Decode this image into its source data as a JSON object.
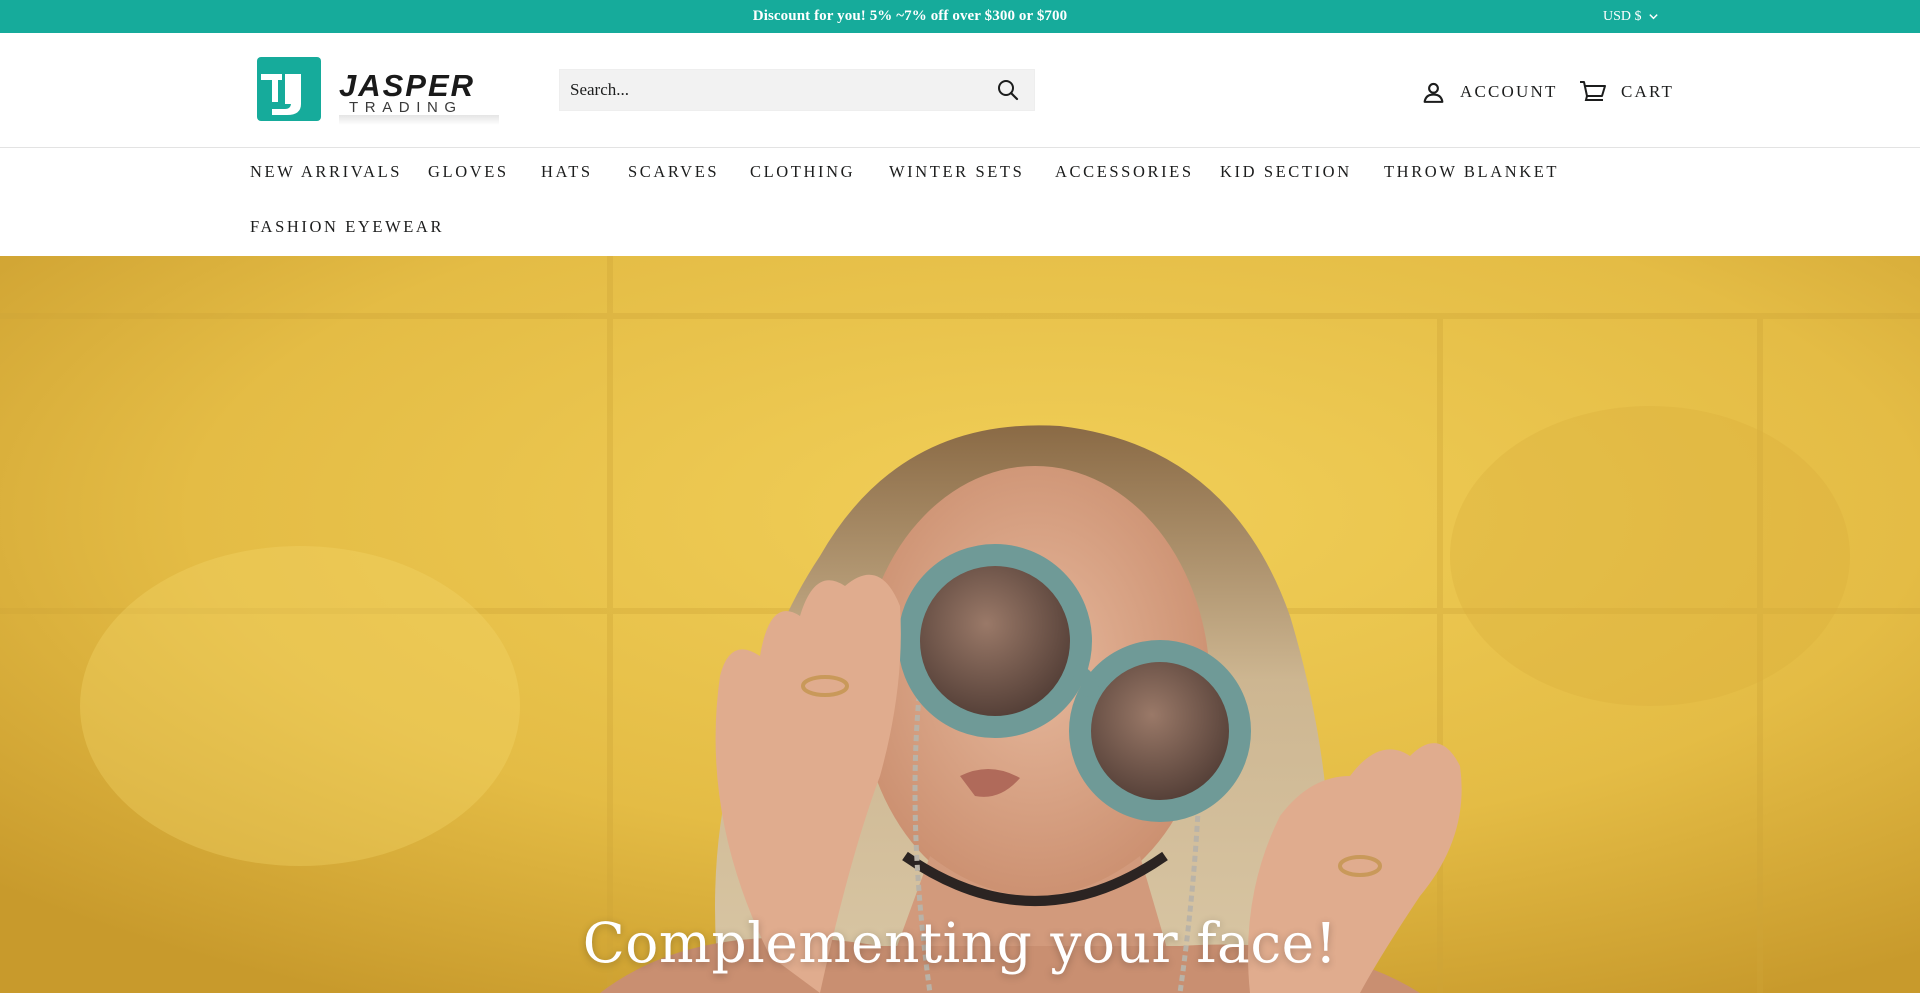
{
  "announcement": {
    "text": "Discount for you! 5% ~7% off over $300 or $700",
    "currency": "USD $",
    "background": "#16ab9b"
  },
  "header": {
    "logo": {
      "line1": "JASPER",
      "line2": "TRADING",
      "accent": "#16ab9b"
    },
    "search": {
      "placeholder": "Search...",
      "icon": "search-icon"
    },
    "account": {
      "label": "ACCOUNT",
      "icon": "user-icon"
    },
    "cart": {
      "label": "CART",
      "icon": "cart-icon"
    }
  },
  "nav": {
    "items": [
      {
        "label": "NEW ARRIVALS"
      },
      {
        "label": "GLOVES"
      },
      {
        "label": "HATS"
      },
      {
        "label": "SCARVES"
      },
      {
        "label": "CLOTHING"
      },
      {
        "label": "WINTER SETS"
      },
      {
        "label": "ACCESSORIES"
      },
      {
        "label": "KID SECTION"
      },
      {
        "label": "THROW BLANKET"
      },
      {
        "label": "FASHION EYEWEAR"
      }
    ]
  },
  "hero": {
    "title": "Complementing your face!",
    "background": "#e6c04a"
  }
}
